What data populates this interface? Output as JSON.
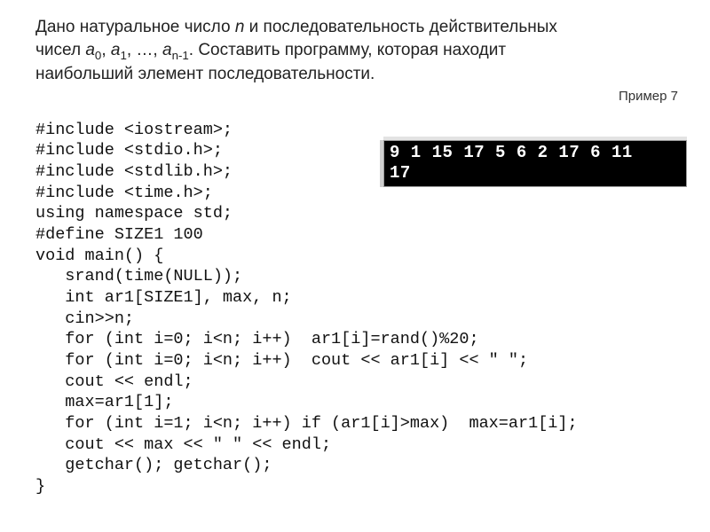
{
  "problem": {
    "line1_pre": "Дано натуральное число ",
    "line1_var1": "n",
    "line1_mid": " и последовательность действительных",
    "line2_pre": "чисел ",
    "seq_a": "a",
    "sub0": "0",
    "comma": ", ",
    "sub1": "1",
    "ellipsis": ", …, ",
    "subn1": "n-1",
    "line2_post": ". Составить программу, которая находит",
    "line3": "наибольший элемент последовательности."
  },
  "example_label": "Пример 7",
  "code_lines": [
    "#include <iostream>;",
    "#include <stdio.h>;",
    "#include <stdlib.h>;",
    "#include <time.h>;",
    "using namespace std;",
    "#define SIZE1 100",
    "void main() {",
    "   srand(time(NULL));",
    "   int ar1[SIZE1], max, n;",
    "   cin>>n;",
    "   for (int i=0; i<n; i++)  ar1[i]=rand()%20;",
    "   for (int i=0; i<n; i++)  cout << ar1[i] << \" \";",
    "   cout << endl;",
    "   max=ar1[1];",
    "   for (int i=1; i<n; i++) if (ar1[i]>max)  max=ar1[i];",
    "   cout << max << \" \" << endl;",
    "   getchar(); getchar();",
    "}"
  ],
  "console": {
    "row1": "9 1 15 17 5 6 2 17 6 11",
    "row2": "17"
  }
}
